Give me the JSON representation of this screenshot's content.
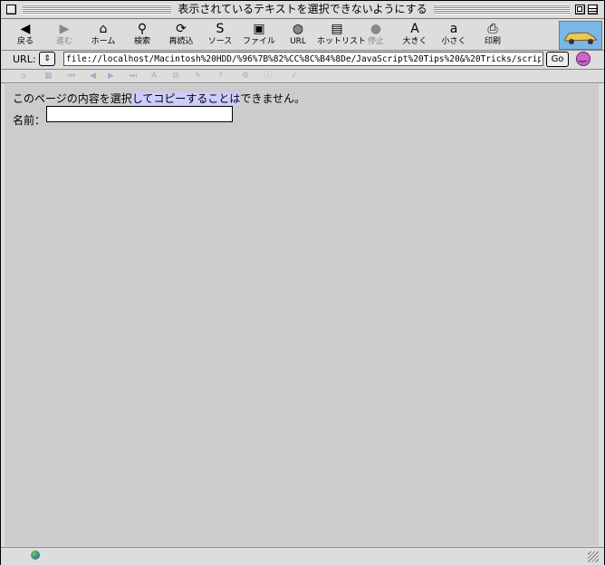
{
  "window": {
    "title": "表示されているテキストを選択できないようにする"
  },
  "toolbar": {
    "buttons": [
      {
        "label": "戻る",
        "icon": "◀",
        "enabled": true
      },
      {
        "label": "進む",
        "icon": "▶",
        "enabled": false
      },
      {
        "label": "ホーム",
        "icon": "⌂",
        "enabled": true
      },
      {
        "label": "検索",
        "icon": "⚲",
        "enabled": true
      },
      {
        "label": "再読込",
        "icon": "⟳",
        "enabled": true
      },
      {
        "label": "ソース",
        "icon": "S",
        "enabled": true
      },
      {
        "label": "ファイル",
        "icon": "▣",
        "enabled": true
      },
      {
        "label": "URL",
        "icon": "◍",
        "enabled": true
      },
      {
        "label": "ホットリスト",
        "icon": "▤",
        "enabled": true
      },
      {
        "label": "停止",
        "icon": "●",
        "enabled": false
      },
      {
        "label": "大きく",
        "icon": "A",
        "enabled": true
      },
      {
        "label": "小さく",
        "icon": "a",
        "enabled": true
      },
      {
        "label": "印刷",
        "icon": "⎙",
        "enabled": true
      }
    ]
  },
  "location": {
    "label": "URL:",
    "value": "file://localhost/Macintosh%20HDD/%96%7B%82%CC%8C%B4%8De/JavaScript%20Tips%20&%20Tricks/scrip",
    "go_label": "Go"
  },
  "page": {
    "notice_normal": "このページの内容を選択",
    "notice_selected": "してコピーすることは",
    "notice_tail": "できません。",
    "name_label": "名前：",
    "name_value": ""
  }
}
